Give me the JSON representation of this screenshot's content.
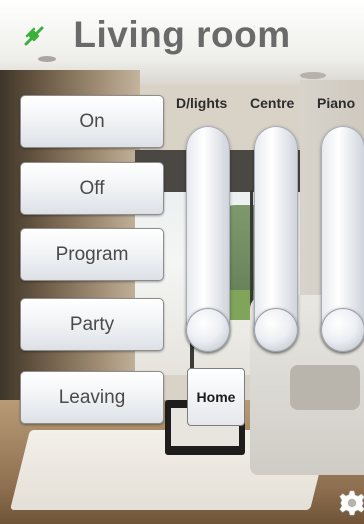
{
  "header": {
    "title": "Living room",
    "status_icon": "plug-disconnected-icon",
    "status_color": "#3bb03b"
  },
  "scenes": [
    {
      "label": "On"
    },
    {
      "label": "Off"
    },
    {
      "label": "Program"
    },
    {
      "label": "Party"
    },
    {
      "label": "Leaving"
    }
  ],
  "faders": [
    {
      "label": "D/lights",
      "level": 0
    },
    {
      "label": "Centre",
      "level": 0
    },
    {
      "label": "Piano",
      "level": 0
    }
  ],
  "home_label": "Home",
  "settings_icon": "gear-icon"
}
